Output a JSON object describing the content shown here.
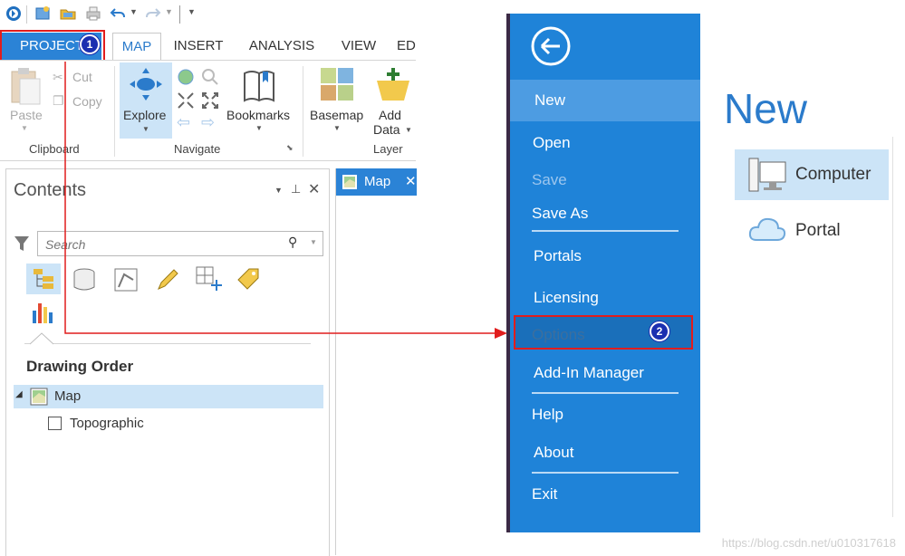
{
  "quick_access": {
    "icons": [
      "arcgis-logo-icon",
      "new-project-icon",
      "open-project-icon",
      "print-icon",
      "undo-icon",
      "redo-icon",
      "customize-icon"
    ]
  },
  "ribbon": {
    "tabs": [
      "PROJECT",
      "MAP",
      "INSERT",
      "ANALYSIS",
      "VIEW",
      "ED"
    ],
    "clipboard": {
      "paste": "Paste",
      "cut": "Cut",
      "copy": "Copy",
      "label": "Clipboard"
    },
    "navigate": {
      "explore": "Explore",
      "bookmarks": "Bookmarks",
      "label": "Navigate"
    },
    "layer": {
      "basemap": "Basemap",
      "add": "Add",
      "data": "Data",
      "label": "Layer"
    }
  },
  "contents": {
    "title": "Contents",
    "search_placeholder": "Search",
    "drawing_order": "Drawing Order",
    "layers": [
      {
        "name": "Map",
        "expanded": true,
        "checked": true
      },
      {
        "name": "Topographic",
        "checked": false
      }
    ]
  },
  "map_view": {
    "tab_label": "Map"
  },
  "backstage": {
    "menu": [
      "New",
      "Open",
      "Save",
      "Save As",
      "Portals",
      "Licensing",
      "Options",
      "Add-In Manager",
      "Help",
      "About",
      "Exit"
    ],
    "selected": "New",
    "disabled": [
      "Save"
    ],
    "page_title": "New",
    "choices": [
      {
        "label": "Computer",
        "selected": true
      },
      {
        "label": "Portal",
        "selected": false
      }
    ]
  },
  "annotations": {
    "badge1": "1",
    "badge2": "2"
  },
  "watermark": "https://blog.csdn.net/u010317618",
  "colors": {
    "accent": "#2b83d6",
    "backstage_blue": "#1f83d8",
    "annotation_red": "#e11d1d",
    "badge_blue": "#1b2fb0"
  }
}
